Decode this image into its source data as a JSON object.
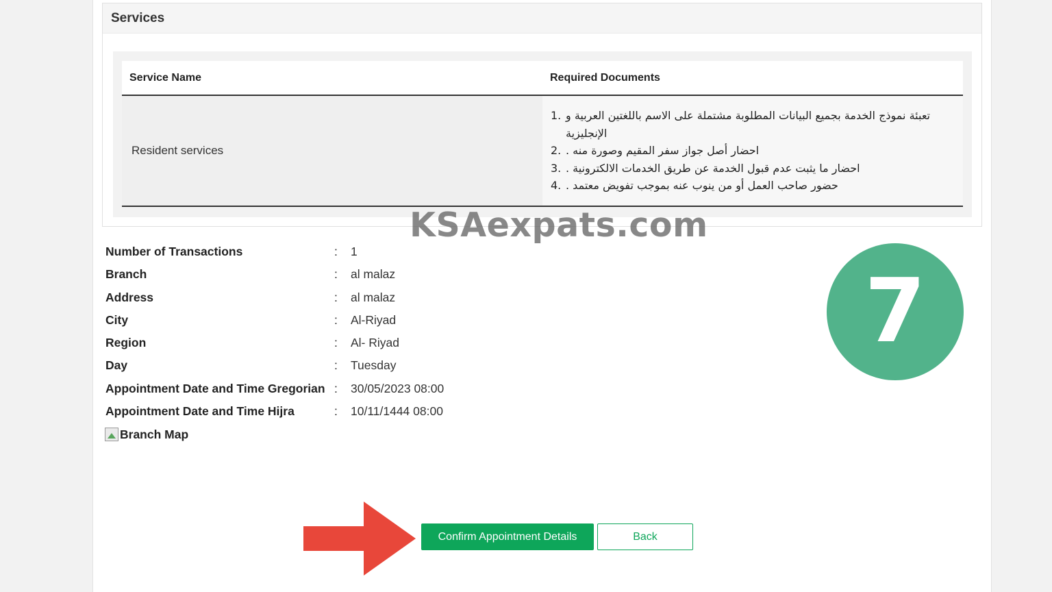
{
  "services": {
    "title": "Services",
    "table": {
      "headers": [
        "Service Name",
        "Required Documents"
      ],
      "service_name": "Resident services",
      "documents": [
        {
          "num": "1.",
          "text": "تعبئة نموذج الخدمة بجميع البيانات المطلوبة مشتملة على الاسم باللغتين العربية و الإنجليزية"
        },
        {
          "num": "2.",
          "text": "احضار أصل جواز سفر المقيم وصورة منه ."
        },
        {
          "num": "3.",
          "text": "احضار ما يثبت عدم قبول الخدمة عن طريق الخدمات الالكترونية ."
        },
        {
          "num": "4.",
          "text": "حضور صاحب العمل أو من ينوب عنه بموجب تفويض معتمد ."
        }
      ]
    }
  },
  "watermark": "KSAexpats.com",
  "details": [
    {
      "label": "Number of Transactions",
      "colon": ":",
      "value": "1"
    },
    {
      "label": "Branch",
      "colon": ":",
      "value": "al malaz"
    },
    {
      "label": "Address",
      "colon": ":",
      "value": "al malaz"
    },
    {
      "label": "City",
      "colon": ":",
      "value": "Al-Riyad"
    },
    {
      "label": "Region",
      "colon": ":",
      "value": "Al- Riyad"
    },
    {
      "label": "Day",
      "colon": ":",
      "value": "Tuesday"
    },
    {
      "label": "Appointment Date and Time Gregorian",
      "colon": ":",
      "value": "30/05/2023 08:00"
    },
    {
      "label": "Appointment Date and Time Hijra",
      "colon": ":",
      "value": "10/11/1444 08:00"
    }
  ],
  "branch_map": {
    "alt": "Branch Map",
    "icon": "broken-image-icon"
  },
  "step_badge": {
    "number": "7",
    "color": "#52b38b"
  },
  "pointer_arrow": {
    "icon": "right-arrow-icon",
    "color": "#e8473a"
  },
  "buttons": {
    "confirm": "Confirm Appointment Details",
    "back": "Back"
  },
  "colors": {
    "primary_green": "#0ea65a",
    "badge_green": "#52b38b",
    "arrow_red": "#e8473a"
  }
}
